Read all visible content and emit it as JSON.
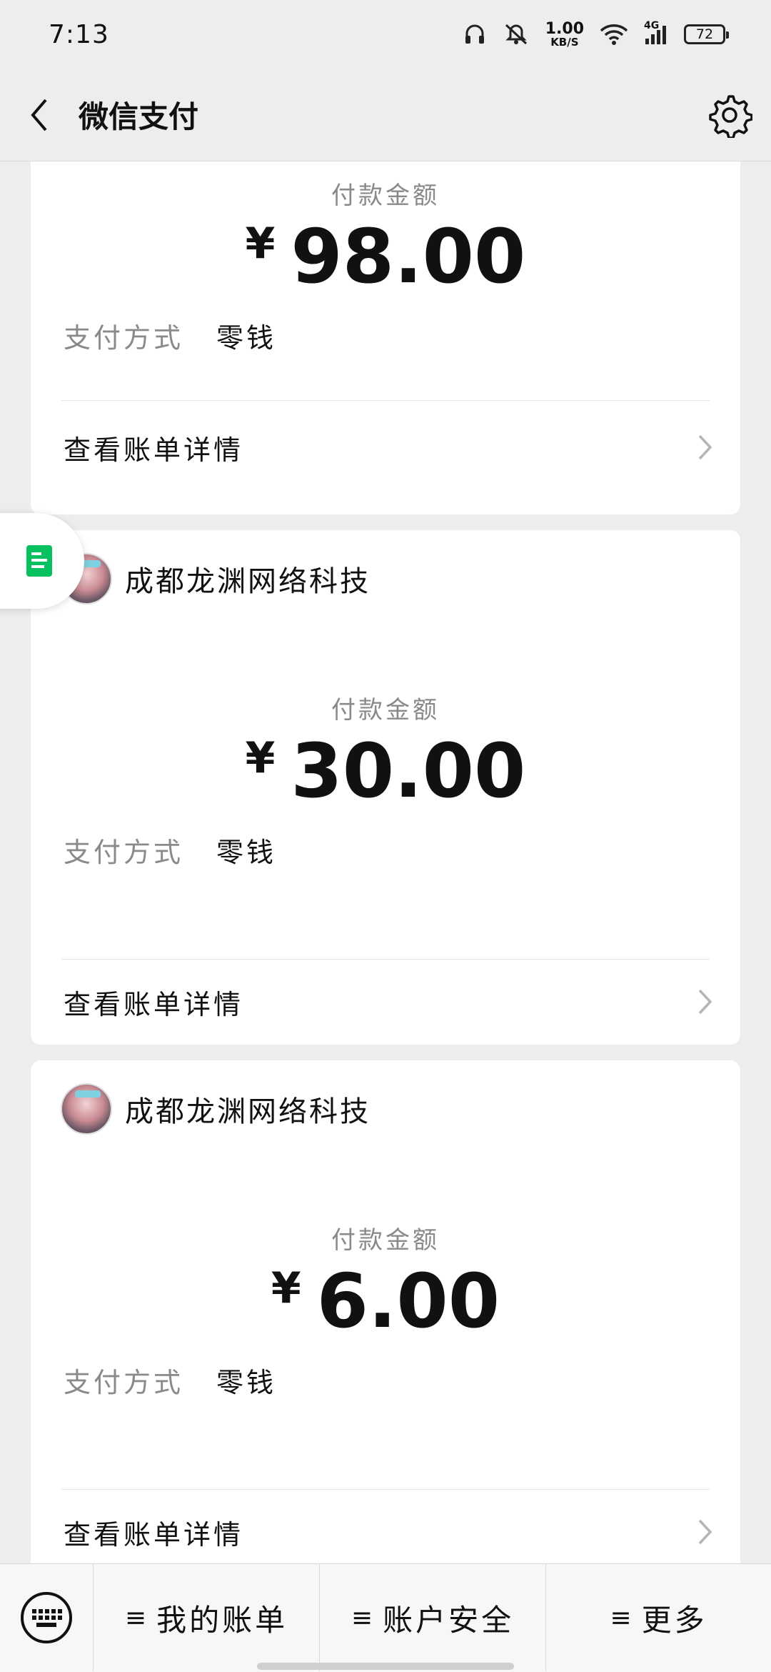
{
  "status_bar": {
    "time": "7:13",
    "net_speed_value": "1.00",
    "net_speed_unit": "KB/S",
    "network_type": "4G",
    "battery_level": "72"
  },
  "nav": {
    "title": "微信支付"
  },
  "cards": [
    {
      "pay_label": "付款金额",
      "currency": "¥",
      "amount": "98.00",
      "method_label": "支付方式",
      "method_value": "零钱",
      "detail_label": "查看账单详情"
    },
    {
      "merchant": "成都龙渊网络科技",
      "pay_label": "付款金额",
      "currency": "¥",
      "amount": "30.00",
      "method_label": "支付方式",
      "method_value": "零钱",
      "detail_label": "查看账单详情"
    },
    {
      "merchant": "成都龙渊网络科技",
      "pay_label": "付款金额",
      "currency": "¥",
      "amount": "6.00",
      "method_label": "支付方式",
      "method_value": "零钱",
      "detail_label": "查看账单详情"
    }
  ],
  "bottom_menu": {
    "item1": "我的账单",
    "item2": "账户安全",
    "item3": "更多",
    "ham_glyph": "≡"
  },
  "colors": {
    "background": "#ededed",
    "card": "#ffffff",
    "accent_green": "#07c160",
    "secondary_text": "#8a8a8a"
  }
}
